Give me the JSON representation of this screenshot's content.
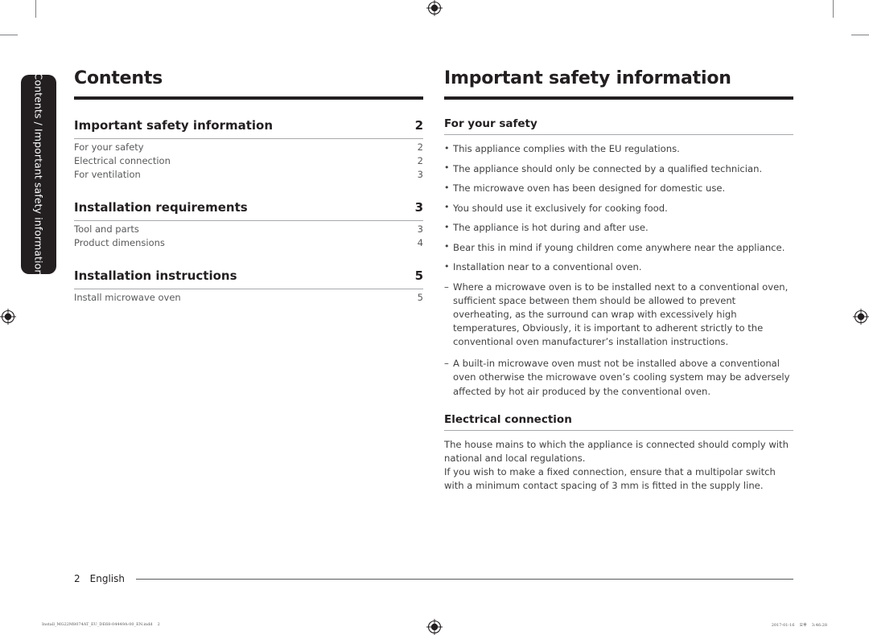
{
  "side_tab": {
    "label": "Contents / Important safety information"
  },
  "left_column": {
    "title": "Contents",
    "toc": [
      {
        "title": "Important safety information",
        "page": "2",
        "children": [
          {
            "title": "For your safety",
            "page": "2"
          },
          {
            "title": "Electrical connection",
            "page": "2"
          },
          {
            "title": "For ventilation",
            "page": "3"
          }
        ]
      },
      {
        "title": "Installation requirements",
        "page": "3",
        "children": [
          {
            "title": "Tool and parts",
            "page": "3"
          },
          {
            "title": "Product dimensions",
            "page": "4"
          }
        ]
      },
      {
        "title": "Installation instructions",
        "page": "5",
        "children": [
          {
            "title": "Install microwave oven",
            "page": "5"
          }
        ]
      }
    ]
  },
  "right_column": {
    "title": "Important safety information",
    "sections": [
      {
        "heading": "For your safety",
        "bullets": [
          "This appliance complies with the EU regulations.",
          "The appliance should only be connected by a qualified technician.",
          "The microwave oven has been designed for domestic use.",
          "You should use it exclusively for cooking food.",
          "The appliance is hot during and after use.",
          "Bear this in mind if young children come anywhere near the appliance.",
          "Installation near to a conventional oven."
        ],
        "dashes": [
          "Where a microwave oven is to be installed next to a conventional oven, sufficient space between them should be allowed to prevent overheating, as the surround can wrap with excessively high temperatures, Obviously, it is important to adherent strictly to the conventional oven manufacturer’s installation instructions.",
          "A built-in microwave oven must not be installed above a conventional oven otherwise the microwave oven’s cooling system may be adversely affected by hot air produced by the conventional oven."
        ]
      },
      {
        "heading": "Electrical connection",
        "paragraphs": [
          "The house mains to which the appliance is connected should comply with national and local regulations.",
          "If you wish to make a fixed connection, ensure that a multipolar switch with a minimum contact spacing of 3 mm is fitted in the supply line."
        ]
      }
    ]
  },
  "footer": {
    "page_number": "2",
    "language": "English"
  },
  "print_slug": {
    "filename": "Install_MG22M8074AT_EU_DE68-04449A-00_EN.indd",
    "slug_page": "2",
    "date": "2017-01-16",
    "meridiem_glyph": "오후",
    "time": "3:46:28"
  },
  "colors": {
    "ink": "#231f20",
    "body_text": "#414042",
    "muted_text": "#58595b",
    "rule_light": "#a7a9ac",
    "tab_background": "#231f20"
  }
}
